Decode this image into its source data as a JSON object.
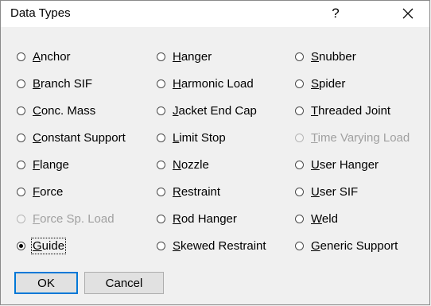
{
  "window": {
    "title": "Data Types",
    "help_label": "?",
    "close_icon": "close-icon"
  },
  "options": [
    {
      "pre": "",
      "u": "A",
      "post": "nchor",
      "enabled": true,
      "selected": false
    },
    {
      "pre": "",
      "u": "B",
      "post": "ranch SIF",
      "enabled": true,
      "selected": false
    },
    {
      "pre": "",
      "u": "C",
      "post": "onc. Mass",
      "enabled": true,
      "selected": false
    },
    {
      "pre": "",
      "u": "C",
      "post": "onstant Support",
      "enabled": true,
      "selected": false
    },
    {
      "pre": "",
      "u": "F",
      "post": "lange",
      "enabled": true,
      "selected": false
    },
    {
      "pre": "",
      "u": "F",
      "post": "orce",
      "enabled": true,
      "selected": false
    },
    {
      "pre": "",
      "u": "F",
      "post": "orce Sp. Load",
      "enabled": false,
      "selected": false
    },
    {
      "pre": "",
      "u": "G",
      "post": "uide",
      "enabled": true,
      "selected": true
    },
    {
      "pre": "",
      "u": "H",
      "post": "anger",
      "enabled": true,
      "selected": false
    },
    {
      "pre": "",
      "u": "H",
      "post": "armonic Load",
      "enabled": true,
      "selected": false
    },
    {
      "pre": "",
      "u": "J",
      "post": "acket End Cap",
      "enabled": true,
      "selected": false
    },
    {
      "pre": "",
      "u": "L",
      "post": "imit Stop",
      "enabled": true,
      "selected": false
    },
    {
      "pre": "",
      "u": "N",
      "post": "ozzle",
      "enabled": true,
      "selected": false
    },
    {
      "pre": "",
      "u": "R",
      "post": "estraint",
      "enabled": true,
      "selected": false
    },
    {
      "pre": "",
      "u": "R",
      "post": "od Hanger",
      "enabled": true,
      "selected": false
    },
    {
      "pre": "",
      "u": "S",
      "post": "kewed Restraint",
      "enabled": true,
      "selected": false
    },
    {
      "pre": "",
      "u": "S",
      "post": "nubber",
      "enabled": true,
      "selected": false
    },
    {
      "pre": "",
      "u": "S",
      "post": "pider",
      "enabled": true,
      "selected": false
    },
    {
      "pre": "",
      "u": "T",
      "post": "hreaded Joint",
      "enabled": true,
      "selected": false
    },
    {
      "pre": "",
      "u": "T",
      "post": "ime Varying Load",
      "enabled": false,
      "selected": false
    },
    {
      "pre": "",
      "u": "U",
      "post": "ser Hanger",
      "enabled": true,
      "selected": false
    },
    {
      "pre": "",
      "u": "U",
      "post": "ser SIF",
      "enabled": true,
      "selected": false
    },
    {
      "pre": "",
      "u": "W",
      "post": "eld",
      "enabled": true,
      "selected": false
    },
    {
      "pre": "",
      "u": "G",
      "post": "eneric Support",
      "enabled": true,
      "selected": false
    }
  ],
  "buttons": {
    "ok_label": "OK",
    "cancel_label": "Cancel"
  }
}
